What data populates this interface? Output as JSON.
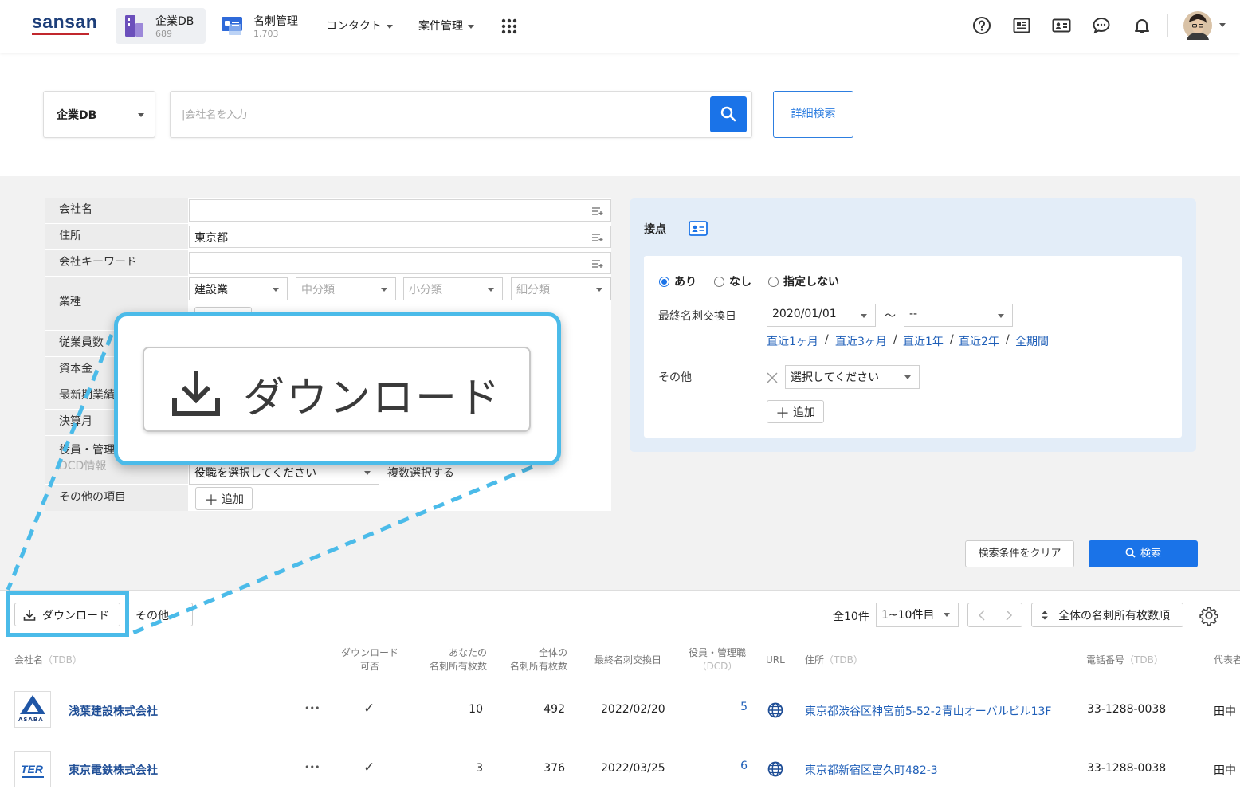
{
  "header": {
    "logo": "sansan",
    "apps": [
      {
        "name": "企業DB",
        "count": "689"
      },
      {
        "name": "名刺管理",
        "count": "1,703"
      }
    ],
    "menus": [
      "コンタクト",
      "案件管理"
    ],
    "icons": [
      "apps-grid-icon",
      "help-icon",
      "news-icon",
      "card-icon",
      "chat-icon",
      "bell-icon",
      "avatar"
    ]
  },
  "search": {
    "db_select": "企業DB",
    "placeholder": "|会社名を入力",
    "advanced": "詳細検索"
  },
  "conditions": {
    "rows": {
      "company": "会社名",
      "address": "住所",
      "keyword": "会社キーワード",
      "industry": "業種",
      "employees": "従業員数",
      "capital": "資本金",
      "latest": "最新期業績",
      "fiscal": "決算月",
      "officers": "役員・管理",
      "dcd": "DCD情報",
      "other": "その他の項目"
    },
    "address_value": "東京都",
    "industry_selects": [
      "建設業",
      "中分類",
      "小分類",
      "細分類"
    ],
    "officer_select": "役職を選択してください",
    "multi_select": "複数選択する",
    "add": "追加"
  },
  "contact": {
    "title": "接点",
    "radios": [
      "あり",
      "なし",
      "指定しない"
    ],
    "date_label": "最終名刺交換日",
    "date_from": "2020/01/01",
    "tilde": "〜",
    "date_to": "--",
    "periods": [
      "直近1ヶ月",
      "直近3ヶ月",
      "直近1年",
      "直近2年",
      "全期間"
    ],
    "sep": "/",
    "other_label": "その他",
    "other_select": "選択してください",
    "add": "追加"
  },
  "actions": {
    "clear": "検索条件をクリア",
    "search": "検索"
  },
  "toolbar": {
    "download": "ダウンロード",
    "other": "その他",
    "total": "全10件",
    "range": "1~10件目",
    "sort": "全体の名刺所有枚数順"
  },
  "columns": {
    "company": "会社名",
    "tdb": "（TDB）",
    "download_1": "ダウンロード",
    "download_2": "可否",
    "yours_1": "あなたの",
    "yours_2": "名刺所有枚数",
    "all_1": "全体の",
    "all_2": "名刺所有枚数",
    "last": "最終名刺交換日",
    "officers": "役員・管理職",
    "dcd": "（DCD）",
    "url": "URL",
    "address": "住所",
    "phone": "電話番号",
    "rep": "代表者"
  },
  "rows": [
    {
      "logo": "ASABA",
      "name": "浅葉建設株式会社",
      "more": "•••",
      "check": "✓",
      "yours": "10",
      "all": "492",
      "date": "2022/02/20",
      "officers": "5",
      "address": "東京都渋谷区神宮前5-52-2青山オーバルビル13F",
      "phone": "33-1288-0038",
      "rep": "田中"
    },
    {
      "logo": "TER",
      "name": "東京電鉄株式会社",
      "more": "•••",
      "check": "✓",
      "yours": "3",
      "all": "376",
      "date": "2022/03/25",
      "officers": "6",
      "address": "東京都新宿区富久町482-3",
      "phone": "33-1288-0038",
      "rep": "田中"
    }
  ],
  "zoom": {
    "label": "ダウンロード"
  },
  "colors": {
    "accent": "#1a73e8",
    "highlight": "#4bbbe9",
    "link": "#1f5fb8",
    "brand_red": "#c1272d"
  }
}
